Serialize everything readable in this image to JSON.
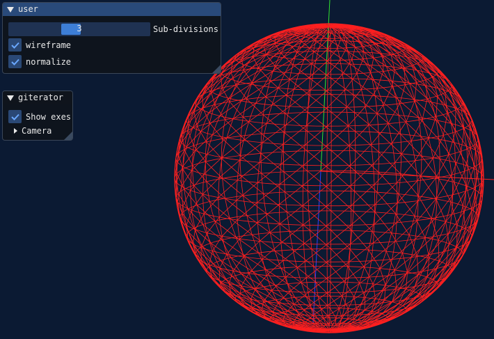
{
  "user_panel": {
    "title": "user",
    "slider": {
      "value": "3",
      "label": "Sub-divisions",
      "fraction": 0.43
    },
    "checkboxes": [
      {
        "label": "wireframe",
        "checked": true
      },
      {
        "label": "normalize",
        "checked": true
      }
    ]
  },
  "giterator_panel": {
    "title": "giterator",
    "checkbox": {
      "label": "Show exes",
      "checked": true
    },
    "tree_node": {
      "label": "Camera",
      "expanded": false
    }
  },
  "scene": {
    "background": "#0b1a33",
    "mesh_color": "#ff2020",
    "axis_colors": {
      "x": "#ff2020",
      "y": "#32e632",
      "z": "#3040ff"
    }
  },
  "icons": [
    "collapse-arrow-icon",
    "check-icon",
    "tree-arrow-icon",
    "resize-grip-icon"
  ]
}
